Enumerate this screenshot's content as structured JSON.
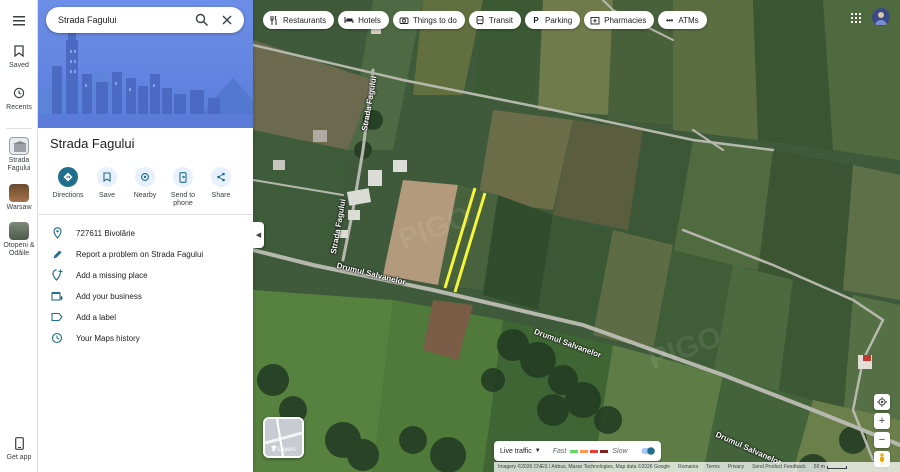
{
  "search": {
    "value": "Strada Fagului"
  },
  "rail": {
    "saved": "Saved",
    "recents": "Recents",
    "items": [
      {
        "label": "Strada Fagului"
      },
      {
        "label": "Warsaw"
      },
      {
        "label": "Otopeni & Odăile"
      }
    ],
    "get_app": "Get app"
  },
  "place": {
    "title": "Strada Fagului",
    "actions": [
      {
        "label": "Directions",
        "icon": "directions-icon"
      },
      {
        "label": "Save",
        "icon": "bookmark-icon"
      },
      {
        "label": "Nearby",
        "icon": "nearby-icon"
      },
      {
        "label": "Send to phone",
        "icon": "send-phone-icon"
      },
      {
        "label": "Share",
        "icon": "share-icon"
      }
    ],
    "info": [
      {
        "text": "727611 Bivolărie",
        "icon": "location-pin-icon"
      },
      {
        "text": "Report a problem on Strada Fagului",
        "icon": "pencil-icon"
      },
      {
        "text": "Add a missing place",
        "icon": "add-place-icon"
      },
      {
        "text": "Add your business",
        "icon": "business-icon"
      },
      {
        "text": "Add a label",
        "icon": "label-icon"
      },
      {
        "text": "Your Maps history",
        "icon": "history-icon"
      }
    ]
  },
  "chips": [
    {
      "label": "Restaurants",
      "icon": "restaurant-icon"
    },
    {
      "label": "Hotels",
      "icon": "hotel-icon"
    },
    {
      "label": "Things to do",
      "icon": "camera-icon"
    },
    {
      "label": "Transit",
      "icon": "transit-icon"
    },
    {
      "label": "Parking",
      "icon": "parking-icon"
    },
    {
      "label": "Pharmacies",
      "icon": "pharmacy-icon"
    },
    {
      "label": "ATMs",
      "icon": "atm-icon"
    }
  ],
  "map": {
    "roads": {
      "strada_fagului_1": "Strada Fagului",
      "strada_fagului_2": "Strada Fagului",
      "drumul_1": "Drumul Salvanelor",
      "drumul_2": "Drumul Salvanelor",
      "drumul_3": "Drumul Salvanelor"
    },
    "layers_label": "Layers",
    "traffic": {
      "label": "Live traffic",
      "fast": "Fast",
      "slow": "Slow"
    },
    "footer": {
      "imagery": "Imagery ©2026 CNES / Airbus, Maxar Technologies, Map data ©2026 Google",
      "country": "Romania",
      "terms": "Terms",
      "privacy": "Privacy",
      "feedback": "Send Product Feedback",
      "scale": "50 m"
    },
    "colors": {
      "highlight": "#f5f53a",
      "accent": "#1f6e8c"
    }
  }
}
